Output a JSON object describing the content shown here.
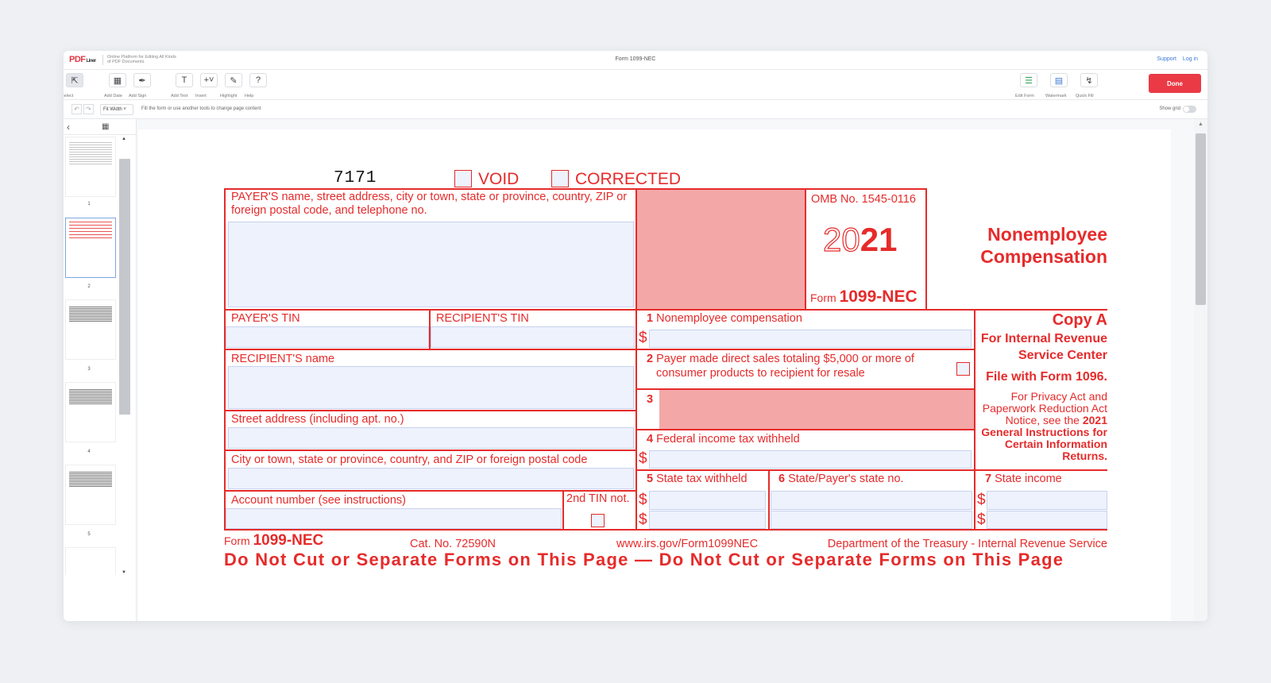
{
  "header": {
    "logo": "PDF",
    "logo_suffix": "Liner",
    "tagline": "Online Platform for Editing All Kinds of PDF Documents",
    "doc_title": "Form 1099-NEC",
    "support": "Support",
    "login": "Log in"
  },
  "toolbar": {
    "tools": [
      {
        "label": "Select",
        "icon": "cursor-icon"
      },
      {
        "label": "Add Date",
        "icon": "calendar-icon"
      },
      {
        "label": "Add Sign",
        "icon": "sign-icon"
      },
      {
        "label": "Add Text",
        "icon": "text-icon"
      },
      {
        "label": "Insert",
        "icon": "plus-icon"
      },
      {
        "label": "Highlight",
        "icon": "highlight-icon"
      },
      {
        "label": "Help",
        "icon": "help-icon"
      }
    ],
    "right_tools": [
      {
        "label": "Edit Form",
        "icon": "edit-form-icon"
      },
      {
        "label": "Watermark",
        "icon": "watermark-icon"
      },
      {
        "label": "Quick Fill",
        "icon": "lightning-icon"
      }
    ],
    "done": "Done"
  },
  "subbar": {
    "zoom": "Fit Width",
    "hint": "Fill the form or use another tools to change page content",
    "show_grid": "Show grid"
  },
  "thumbnails": {
    "pages": [
      "1",
      "2",
      "3",
      "4",
      "5"
    ],
    "selected": "2"
  },
  "form": {
    "form_number_code": "7171",
    "void_label": "VOID",
    "corrected_label": "CORRECTED",
    "payer_label": "PAYER'S name, street address, city or town, state or province, country, ZIP or foreign postal code, and telephone no.",
    "omb": "OMB No. 1545-0116",
    "year_outline": "20",
    "year_bold": "21",
    "form_label_small": "Form",
    "form_name": "1099-NEC",
    "title_line1": "Nonemployee",
    "title_line2": "Compensation",
    "payer_tin": "PAYER'S TIN",
    "recipient_tin": "RECIPIENT'S TIN",
    "box1_num": "1",
    "box1": "Nonemployee compensation",
    "box2_num": "2",
    "box2_line1": "Payer made direct sales totaling $5,000 or more of",
    "box2_line2": "consumer products to recipient for resale",
    "box3_num": "3",
    "box4_num": "4",
    "box4": "Federal income tax withheld",
    "box5_num": "5",
    "box5": "State tax withheld",
    "box6_num": "6",
    "box6": "State/Payer's state no.",
    "box7_num": "7",
    "box7": "State income",
    "recipient_name": "RECIPIENT'S name",
    "street": "Street address (including apt. no.)",
    "city": "City or town, state or province, country, and ZIP or foreign postal code",
    "account": "Account number (see instructions)",
    "second_tin": "2nd TIN not.",
    "dollar": "$",
    "copy_a": "Copy A",
    "for_irs_line1": "For Internal Revenue",
    "for_irs_line2": "Service Center",
    "file_with": "File with Form 1096.",
    "privacy_line1": "For Privacy Act and",
    "privacy_line2": "Paperwork Reduction Act",
    "privacy_line3": "Notice, see the",
    "privacy_year": "2021",
    "privacy_line4": "General Instructions for",
    "privacy_line5": "Certain Information",
    "privacy_line6": "Returns.",
    "footer_form": "Form",
    "footer_form_name": "1099-NEC",
    "footer_cat": "Cat. No. 72590N",
    "footer_url": "www.irs.gov/Form1099NEC",
    "footer_dept": "Department of the Treasury - Internal Revenue Service",
    "do_not_cut": "Do Not Cut or Separate Forms on This Page — Do Not Cut or Separate Forms on This Page"
  },
  "colors": {
    "form_red": "#e62b2b",
    "field_fill": "#eef2fd",
    "shaded": "#f4a7a7",
    "done_button": "#ea3a46",
    "link": "#3b7bd4"
  }
}
